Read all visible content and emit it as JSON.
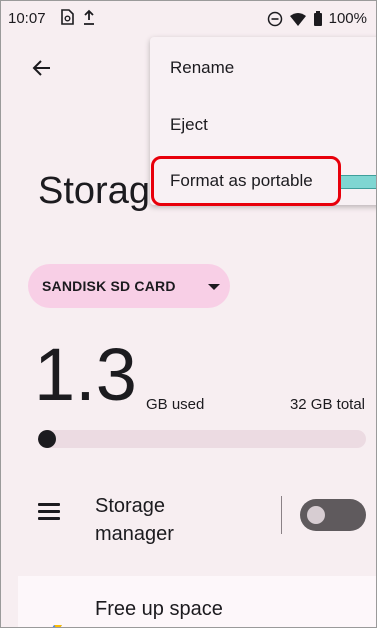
{
  "status_bar": {
    "time": "10:07",
    "battery": "100%",
    "icons": [
      "sim-icon",
      "upload-icon",
      "dnd-icon",
      "wifi-icon",
      "battery-icon"
    ]
  },
  "header": {
    "back_icon": "back-arrow-icon",
    "title": "Storag"
  },
  "menu": {
    "items": [
      "Rename",
      "Eject",
      "Format as portable"
    ],
    "highlighted_item": "Format as portable"
  },
  "storage_selector": {
    "label": "SANDISK SD CARD"
  },
  "usage": {
    "used_value": "1.3",
    "used_unit": "GB used",
    "total_label": "32 GB total",
    "used_fraction": 0.04
  },
  "storage_manager": {
    "label": "Storage manager",
    "toggle_on": false
  },
  "free_up": {
    "label": "Free up space"
  },
  "colors": {
    "background": "#f7eef1",
    "chip": "#f8cfe6",
    "highlight_border": "#e8000b",
    "progress_track": "#ecdbe2"
  }
}
